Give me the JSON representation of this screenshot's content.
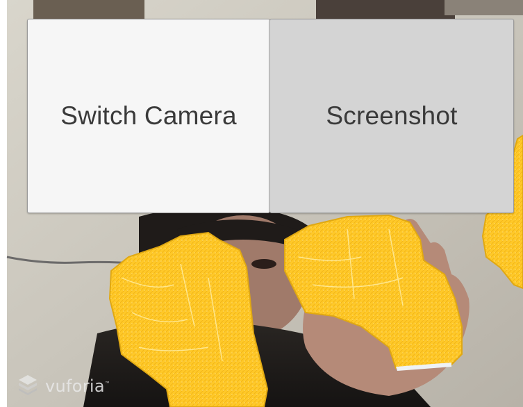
{
  "buttons": {
    "switch_camera": "Switch Camera",
    "screenshot": "Screenshot"
  },
  "branding": {
    "name": "vuforia",
    "trademark": "™"
  },
  "colors": {
    "button_light": "#f6f6f6",
    "button_dark": "#d4d4d4",
    "button_text": "#3a3a3a",
    "overlay_yellow": "#ffc928"
  }
}
